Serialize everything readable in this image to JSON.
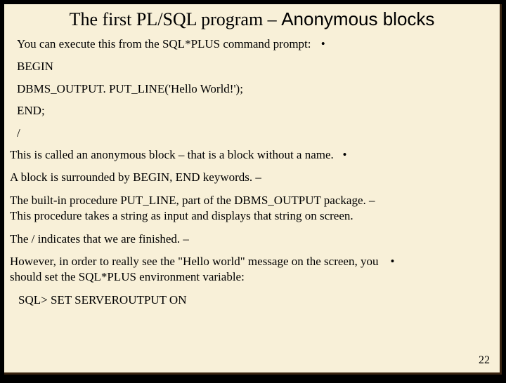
{
  "title_part1": "The first PL/SQL program – ",
  "title_part2": "Anonymous blocks",
  "intro": "You can execute this from the SQL*PLUS command prompt:",
  "code_begin": "BEGIN",
  "code_line": "DBMS_OUTPUT. PUT_LINE('Hello World!');",
  "code_end": "END;",
  "code_slash": "/",
  "anon_block": "This is called an anonymous block – that is a block without a name.",
  "begin_end": "A block is surrounded by BEGIN, END keywords.   –",
  "put_line_1": "The built-in procedure PUT_LINE, part of the DBMS_OUTPUT package.    –",
  "put_line_2": "This procedure takes a string as input and displays that string on screen.",
  "slash_note": "The / indicates that we are finished.   –",
  "however_1": "However, in order to really see the \"Hello world\" message on the screen, you",
  "however_2": " should set the SQL*PLUS environment variable:",
  "sql_cmd": "SQL> SET SERVEROUTPUT ON",
  "bullet": "•",
  "page_number": "22"
}
